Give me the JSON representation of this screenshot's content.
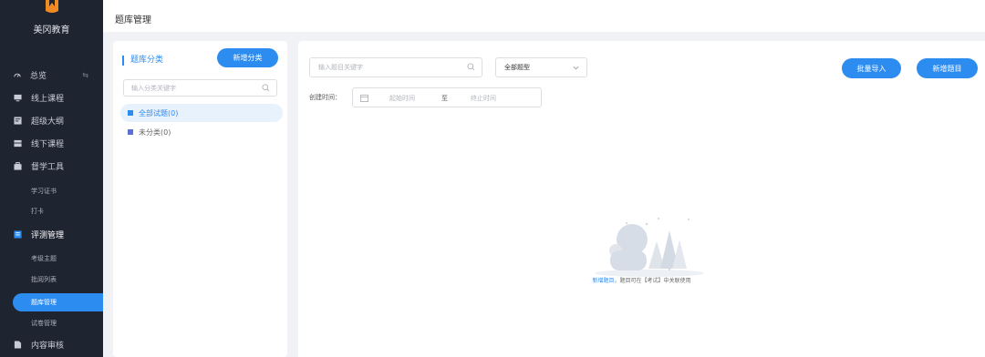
{
  "brand": {
    "name": "美冈教育"
  },
  "header": {
    "title": "题库管理"
  },
  "sidebar": {
    "items": [
      {
        "label": "总览",
        "icon": "dashboard-icon",
        "trailing": "⇆"
      },
      {
        "label": "线上课程",
        "icon": "monitor-icon"
      },
      {
        "label": "超级大纲",
        "icon": "outline-icon"
      },
      {
        "label": "线下课程",
        "icon": "offline-course-icon"
      },
      {
        "label": "督学工具",
        "icon": "toolbox-icon"
      }
    ],
    "tool_subitems": [
      {
        "label": "学习证书"
      },
      {
        "label": "打卡"
      }
    ],
    "assessment": {
      "label": "评测管理",
      "icon": "assessment-icon"
    },
    "assessment_subitems": [
      {
        "label": "考级主题"
      },
      {
        "label": "批阅列表"
      },
      {
        "label": "题库管理"
      },
      {
        "label": "试卷管理"
      }
    ],
    "content_review": {
      "label": "内容审核",
      "icon": "document-icon"
    }
  },
  "category_panel": {
    "title": "题库分类",
    "add_button": "新增分类",
    "search_placeholder": "输入分类关键字",
    "items": [
      {
        "label": "全部试题(0)"
      },
      {
        "label": "未分类(0)"
      }
    ]
  },
  "filters": {
    "keyword_placeholder": "输入题目关键字",
    "type_select": "全部题型",
    "time_label": "创建时间：",
    "start_placeholder": "起始时间",
    "range_separator": "至",
    "end_placeholder": "终止时间"
  },
  "actions": {
    "batch_import": "批量导入",
    "add_question": "新增题目"
  },
  "empty_state": {
    "link": "新增题目",
    "text": "，题目可在【考试】中关联使用"
  },
  "colors": {
    "accent": "#2d8cf0",
    "sidebar_bg": "#1f2431"
  }
}
